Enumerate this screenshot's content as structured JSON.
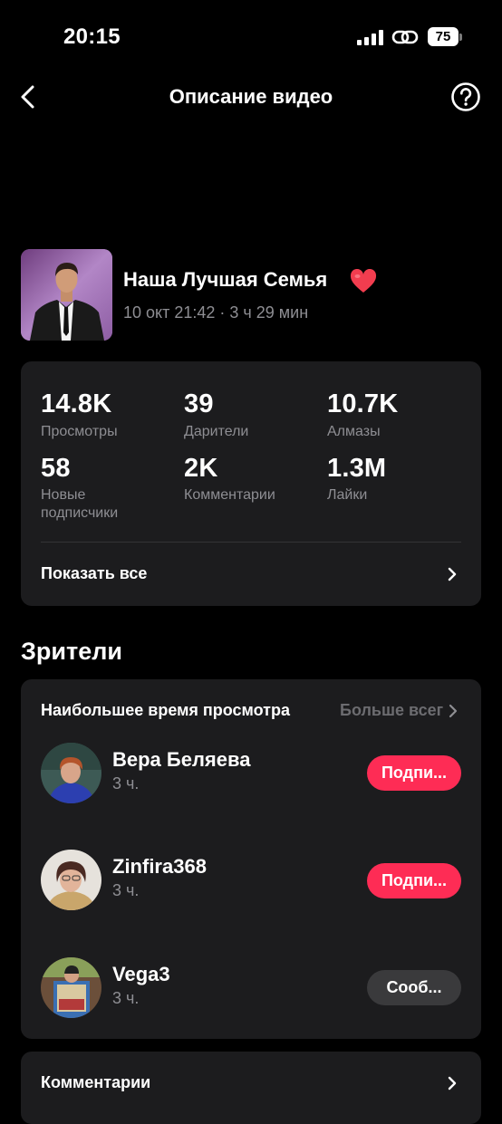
{
  "status_bar": {
    "time": "20:15",
    "battery": "75"
  },
  "header": {
    "title": "Описание видео"
  },
  "video": {
    "title": "Наша Лучшая Семья",
    "meta": "10 окт 21:42 · 3 ч 29 мин"
  },
  "stats": [
    {
      "value": "14.8K",
      "label": "Просмотры"
    },
    {
      "value": "39",
      "label": "Дарители"
    },
    {
      "value": "10.7K",
      "label": "Алмазы"
    },
    {
      "value": "58",
      "label": "Новые подписчики"
    },
    {
      "value": "2K",
      "label": "Комментарии"
    },
    {
      "value": "1.3M",
      "label": "Лайки"
    }
  ],
  "show_all_label": "Показать все",
  "viewers": {
    "section_title": "Зрители",
    "heading": "Наибольшее время просмотра",
    "more_label": "Больше всег",
    "list": [
      {
        "name": "Вера Беляева",
        "time": "3 ч.",
        "action": "Подпи..."
      },
      {
        "name": "Zinfira368",
        "time": "3 ч.",
        "action": "Подпи..."
      },
      {
        "name": "Vega3",
        "time": "3 ч.",
        "action": "Сооб..."
      }
    ]
  },
  "comments": {
    "title": "Комментарии"
  },
  "colors": {
    "accent": "#fe2c55",
    "card": "#1c1c1e",
    "muted": "#8e8e93"
  }
}
